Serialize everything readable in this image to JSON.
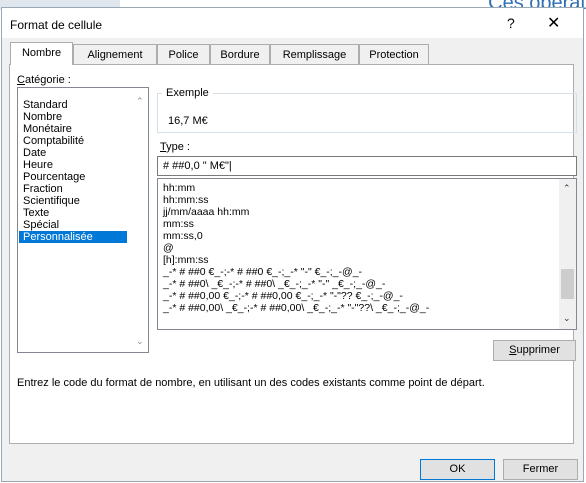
{
  "background": {
    "text": "Ces opérat"
  },
  "dialog": {
    "title": "Format de cellule",
    "help": "?",
    "close": "✕"
  },
  "tabs": [
    "Nombre",
    "Alignement",
    "Police",
    "Bordure",
    "Remplissage",
    "Protection"
  ],
  "active_tab": "Nombre",
  "category": {
    "label_accel": "C",
    "label_rest": "atégorie :",
    "items": [
      "Standard",
      "Nombre",
      "Monétaire",
      "Comptabilité",
      "Date",
      "Heure",
      "Pourcentage",
      "Fraction",
      "Scientifique",
      "Texte",
      "Spécial",
      "Personnalisée"
    ],
    "selected": "Personnalisée"
  },
  "sample": {
    "group_title": "Exemple",
    "value": "16,7 M€"
  },
  "type": {
    "label_accel": "T",
    "label_rest": "ype :",
    "value": "# ##0,0  \" M€\"|"
  },
  "formats": [
    "hh:mm",
    "hh:mm:ss",
    "jj/mm/aaaa hh:mm",
    "mm:ss",
    "mm:ss,0",
    "@",
    "[h]:mm:ss",
    "_-* # ##0 €_-;-* # ##0 €_-;_-* \"-\" €_-;_-@_-",
    "_-* # ##0\\ _€_-;-* # ##0\\ _€_-;_-* \"-\" _€_-;_-@_-",
    "_-* # ##0,00 €_-;-* # ##0,00 €_-;_-* \"-\"?? €_-;_-@_-",
    "_-* # ##0,00\\ _€_-;-* # ##0,00\\ _€_-;_-* \"-\"??\\ _€_-;_-@_-"
  ],
  "buttons": {
    "delete_accel": "S",
    "delete_rest": "upprimer",
    "ok": "OK",
    "cancel": "Fermer"
  },
  "description": "Entrez le code du format de nombre, en utilisant un des codes existants comme point de départ.",
  "colors": {
    "selection": "#0078d7",
    "dialog_bg": "#f0f0f0"
  }
}
